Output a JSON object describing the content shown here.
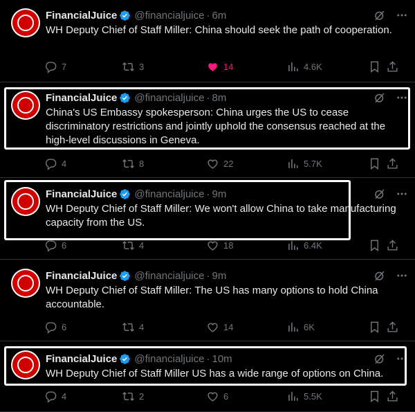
{
  "tweets": [
    {
      "name": "FinancialJuice",
      "handle": "@financialjuice",
      "dot": "·",
      "time": "6m",
      "text": "WH Deputy Chief of Staff Miller: China should seek the path of cooperation.",
      "replies": "7",
      "reposts": "3",
      "likes": "14",
      "liked": true,
      "views": "4.6K"
    },
    {
      "name": "FinancialJuice",
      "handle": "@financialjuice",
      "dot": "·",
      "time": "8m",
      "text": "China's US Embassy spokesperson: China urges the US to cease discriminatory restrictions and jointly uphold the consensus reached at the high-level discussions in Geneva.",
      "replies": "4",
      "reposts": "8",
      "likes": "22",
      "liked": false,
      "views": "5.7K"
    },
    {
      "name": "FinancialJuice",
      "handle": "@financialjuice",
      "dot": "·",
      "time": "9m",
      "text": "WH Deputy Chief of Staff Miller: We won't allow China to take manufacturing capacity from the US.",
      "replies": "6",
      "reposts": "4",
      "likes": "18",
      "liked": false,
      "views": "6.4K"
    },
    {
      "name": "FinancialJuice",
      "handle": "@financialjuice",
      "dot": "·",
      "time": "9m",
      "text": "WH Deputy Chief of Staff Miller: The US has many options to hold China accountable.",
      "replies": "6",
      "reposts": "4",
      "likes": "14",
      "liked": false,
      "views": "6K"
    },
    {
      "name": "FinancialJuice",
      "handle": "@financialjuice",
      "dot": "·",
      "time": "10m",
      "text": "WH Deputy Chief of Staff Miller US has a wide range of options on China.",
      "replies": "4",
      "reposts": "2",
      "likes": "6",
      "liked": false,
      "views": "5.5K"
    }
  ],
  "colors": {
    "background": "#000000",
    "text": "#e7e9ea",
    "muted": "#71767b",
    "verified": "#1d9bf0",
    "like": "#f91880",
    "avatar_red": "#d10000",
    "highlight_box": "#ffffff"
  },
  "icons": [
    "verified-badge-icon",
    "grok-icon",
    "more-icon",
    "reply-icon",
    "repost-icon",
    "like-icon",
    "views-icon",
    "bookmark-icon",
    "share-icon"
  ]
}
